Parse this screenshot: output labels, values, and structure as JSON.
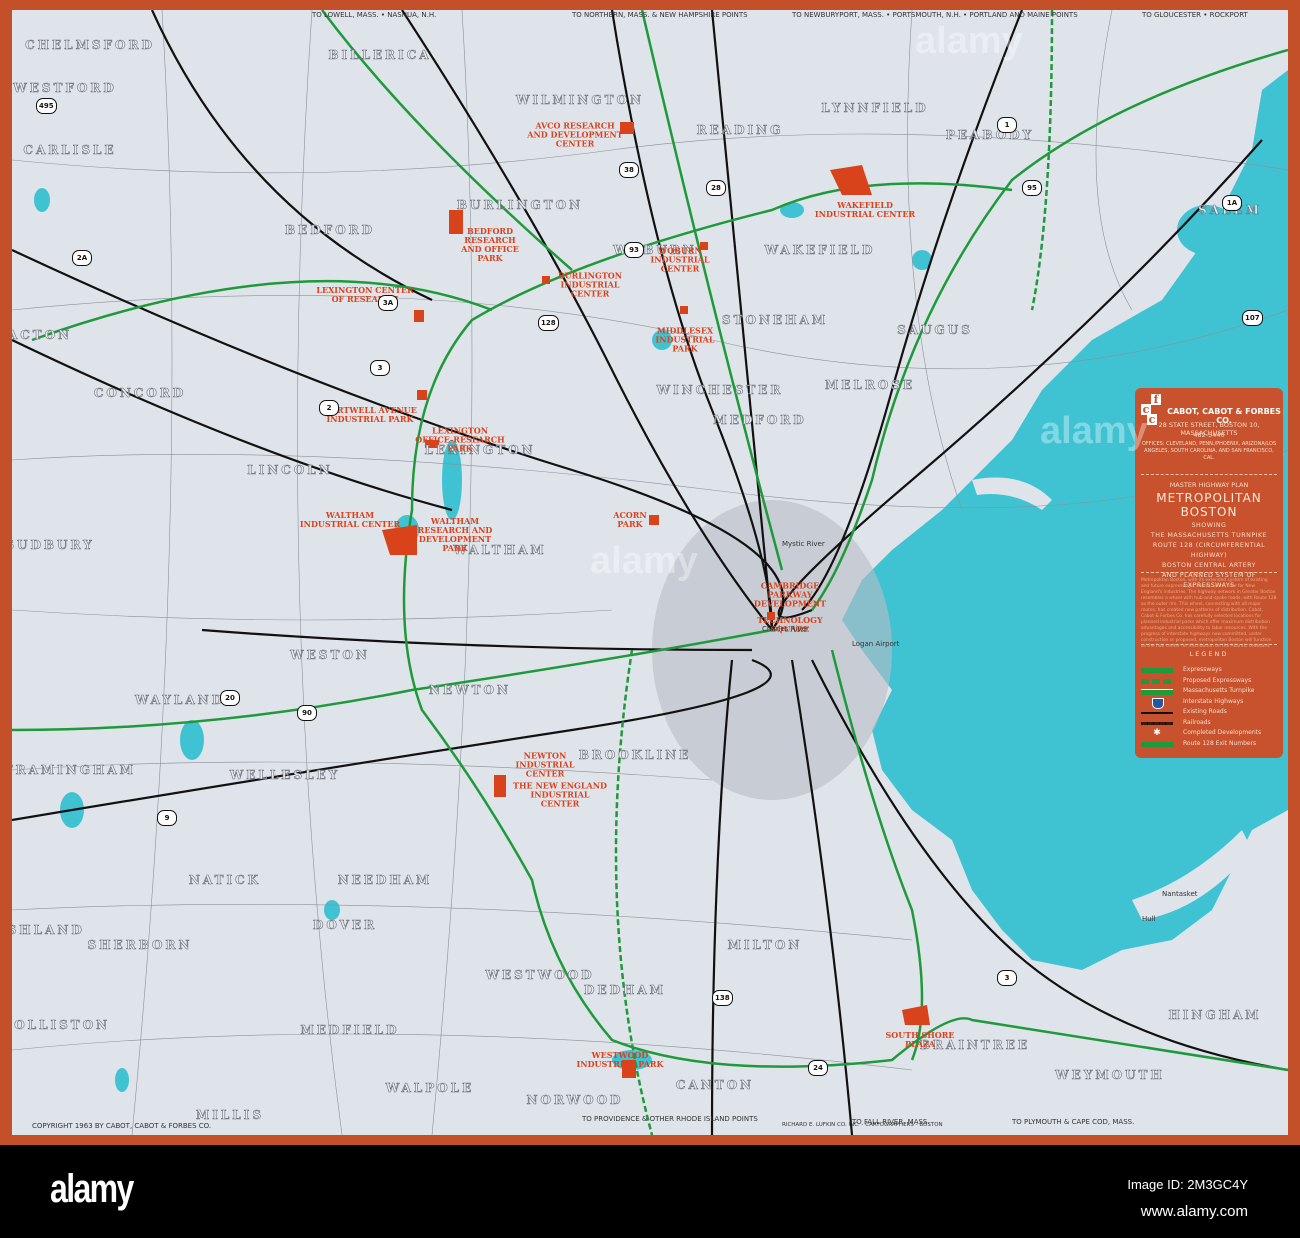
{
  "colors": {
    "border": "#c4502a",
    "land": "#dfe3ea",
    "water": "#3fc3d3",
    "expressway": "#1f9a3a",
    "road": "#111111",
    "development": "#d8431c",
    "panel": "#c8522d"
  },
  "towns": [
    "CHELMSFORD",
    "WESTFORD",
    "BILLERICA",
    "WILMINGTON",
    "READING",
    "LYNNFIELD",
    "PEABODY",
    "CARLISLE",
    "BURLINGTON",
    "BEDFORD",
    "WOBURN",
    "WAKEFIELD",
    "SALEM",
    "STONEHAM",
    "SAUGUS",
    "ACTON",
    "CONCORD",
    "WINCHESTER",
    "MEDFORD",
    "MELROSE",
    "LEXINGTON",
    "LINCOLN",
    "SUDBURY",
    "WALTHAM",
    "WESTON",
    "WAYLAND",
    "NEWTON",
    "FRAMINGHAM",
    "WELLESLEY",
    "BROOKLINE",
    "NATICK",
    "NEEDHAM",
    "ASHLAND",
    "SHERBORN",
    "DOVER",
    "WESTWOOD",
    "HOLLISTON",
    "MEDFIELD",
    "MILLIS",
    "WALPOLE",
    "NORWOOD",
    "CANTON",
    "MILTON",
    "DEDHAM",
    "BRAINTREE",
    "HINGHAM",
    "WEYMOUTH"
  ],
  "developments": [
    "AVCO RESEARCH\nAND DEVELOPMENT\nCENTER",
    "BEDFORD\nRESEARCH\nAND OFFICE\nPARK",
    "LEXINGTON CENTER\nOF RESEARCH",
    "BURLINGTON\nINDUSTRIAL\nCENTER",
    "WOBURN\nINDUSTRIAL\nCENTER",
    "WAKEFIELD\nINDUSTRIAL CENTER",
    "MIDDLESEX\nINDUSTRIAL\nPARK",
    "HARTWELL AVENUE\nINDUSTRIAL PARK",
    "LEXINGTON\nOFFICE-RESEARCH\nPARK",
    "WALTHAM\nINDUSTRIAL CENTER",
    "WALTHAM\nRESEARCH AND\nDEVELOPMENT\nPARK",
    "ACORN\nPARK",
    "CAMBRIDGE\nPARKWAY\nDEVELOPMENT",
    "TECHNOLOGY\nSQUARE",
    "NEWTON\nINDUSTRIAL\nCENTER",
    "THE NEW ENGLAND\nINDUSTRIAL\nCENTER",
    "WESTWOOD\nINDUSTRIAL PARK",
    "SOUTH SHORE\nPLAZA"
  ],
  "route_shields": [
    "495",
    "2A",
    "2",
    "3A",
    "3",
    "93",
    "28",
    "38",
    "1",
    "95",
    "128",
    "1A",
    "107",
    "20",
    "90",
    "9",
    "138",
    "24",
    "3"
  ],
  "place_labels": [
    "Logan Airport",
    "Charles River",
    "Mystic River",
    "Nantasket",
    "Hull"
  ],
  "margin_notes": {
    "top_left": "TO LOWELL, MASS. • NASHUA, N.H.",
    "top_mid": "TO NORTHERN, MASS. & NEW HAMPSHIRE POINTS",
    "top_right": "TO NEWBURYPORT, MASS. • PORTSMOUTH, N.H. • PORTLAND AND MAINE POINTS",
    "top_far_right": "TO GLOUCESTER • ROCKPORT",
    "bottom_mid": "TO PROVIDENCE & OTHER RHODE ISLAND POINTS",
    "bottom_fall": "TO FALL RIVER, MASS.",
    "bottom_cape": "TO PLYMOUTH & CAPE COD, MASS.",
    "copyright": "COPYRIGHT 1963 BY CABOT, CABOT & FORBES CO.",
    "cartographer": "RICHARD E. LUFKIN CO. INC. - CARTOGRAPHERS - BOSTON"
  },
  "panel": {
    "company": "CABOT, CABOT & FORBES CO.",
    "address": "28 STATE STREET, BOSTON 10, MASSACHUSETTS",
    "phone": "482-5440",
    "offices": "OFFICES: CLEVELAND, PENN./PHOENIX, ARIZONA/LOS ANGELES, SOUTH CAROLINA, AND SAN FRANCISCO, CAL.",
    "plan": "MASTER HIGHWAY PLAN",
    "title_1": "METROPOLITAN",
    "title_2": "BOSTON",
    "showing": "SHOWING",
    "line_1": "THE MASSACHUSETTS TURNPIKE",
    "line_2": "ROUTE 128 (CIRCUMFERENTIAL HIGHWAY)",
    "line_3": "BOSTON CENTRAL ARTERY",
    "line_4": "AND PLANNED SYSTEM OF EXPRESSWAYS",
    "body": "Metropolitan Boston, with its extended system of existing and future expressways, serves as the core for New England's industries. The highway network in Greater Boston resembles a wheel with hub-and-spoke roads, with Route 128 as the outer rim. This wheel, connecting with all major routes, has created new patterns of distribution. Cabot, Cabot & Forbes Co. has carefully selected locations for planned industrial parks which offer maximum distribution advantages and accessibility to labor resources. With the progress of interstate highways now committed, under construction or proposed, metropolitan Boston will function as the hub center for distribution on the Atlantic seaboard.",
    "legend_title": "LEGEND",
    "legend": [
      {
        "label": "Expressways",
        "icon": "expressway-line"
      },
      {
        "label": "Proposed Expressways",
        "icon": "dashed-expressway-line"
      },
      {
        "label": "Massachusetts Turnpike",
        "icon": "turnpike-line"
      },
      {
        "label": "Interstate Highways",
        "icon": "interstate-shield"
      },
      {
        "label": "Existing Roads",
        "icon": "road-line"
      },
      {
        "label": "Railroads",
        "icon": "railroad-line"
      },
      {
        "label": "Completed Developments",
        "icon": "asterisk"
      },
      {
        "label": "Route 128 Exit Numbers",
        "icon": "exit-line"
      }
    ]
  },
  "footer": {
    "brand": "alamy",
    "image_id": "Image ID: 2M3GC4Y",
    "url": "www.alamy.com",
    "watermark": "alamy"
  }
}
